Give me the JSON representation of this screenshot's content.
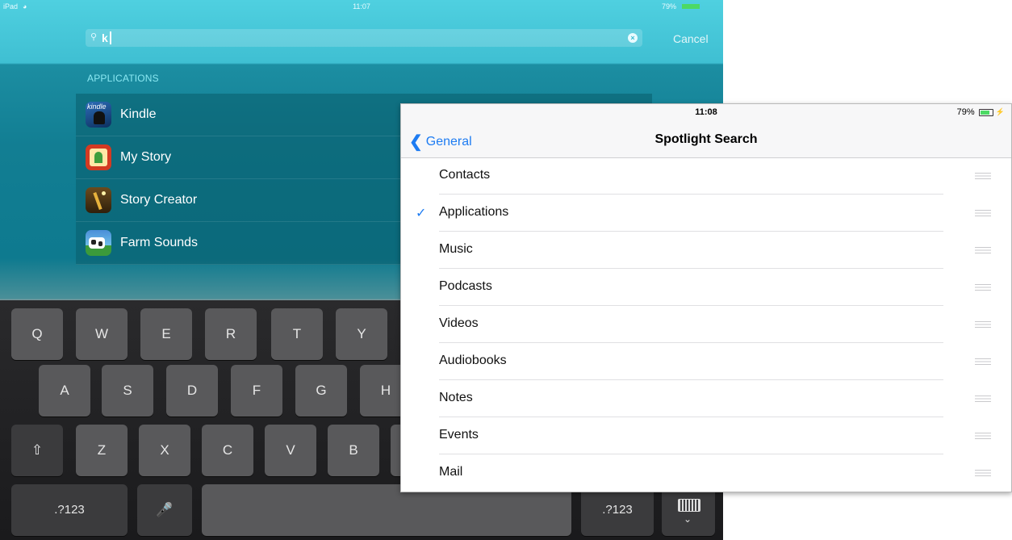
{
  "back_screen": {
    "status_bar": {
      "left": "iPad",
      "time": "11:07",
      "battery": "79%"
    },
    "search": {
      "query": "k",
      "cancel_label": "Cancel"
    },
    "section_header": "APPLICATIONS",
    "results": [
      {
        "label": "Kindle",
        "icon": "kindle-app-icon"
      },
      {
        "label": "My Story",
        "icon": "my-story-app-icon"
      },
      {
        "label": "Story Creator",
        "icon": "story-creator-app-icon"
      },
      {
        "label": "Farm Sounds",
        "icon": "farm-sounds-app-icon"
      }
    ],
    "keyboard": {
      "row1": [
        "Q",
        "W",
        "E",
        "R",
        "T",
        "Y"
      ],
      "row2": [
        "A",
        "S",
        "D",
        "F",
        "G",
        "H"
      ],
      "row3": [
        "Z",
        "X",
        "C",
        "V",
        "B"
      ],
      "numbers_left": ".?123",
      "numbers_right": ".?123"
    }
  },
  "settings": {
    "status_bar": {
      "time": "11:08",
      "battery": "79%"
    },
    "back_label": "General",
    "title": "Spotlight Search",
    "items": [
      {
        "label": "Contacts",
        "checked": false
      },
      {
        "label": "Applications",
        "checked": true
      },
      {
        "label": "Music",
        "checked": false
      },
      {
        "label": "Podcasts",
        "checked": false
      },
      {
        "label": "Videos",
        "checked": false
      },
      {
        "label": "Audiobooks",
        "checked": false
      },
      {
        "label": "Notes",
        "checked": false
      },
      {
        "label": "Events",
        "checked": false
      },
      {
        "label": "Mail",
        "checked": false
      }
    ]
  },
  "colors": {
    "ios_blue": "#1e7cf2",
    "spotlight_teal": "#3fbfd2",
    "battery_green": "#4cd964"
  }
}
